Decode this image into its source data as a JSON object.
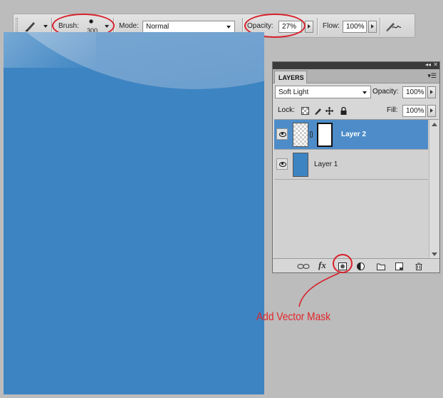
{
  "options_bar": {
    "brush_label": "Brush:",
    "brush_size": "300",
    "mode_label": "Mode:",
    "mode_value": "Normal",
    "opacity_label": "Opacity:",
    "opacity_value": "27%",
    "flow_label": "Flow:",
    "flow_value": "100%"
  },
  "layers_panel": {
    "tab_label": "LAYERS",
    "blend_mode": "Soft Light",
    "opacity_label": "Opacity:",
    "opacity_value": "100%",
    "lock_label": "Lock:",
    "fill_label": "Fill:",
    "fill_value": "100%",
    "layers": [
      {
        "name": "Layer 2",
        "selected": true
      },
      {
        "name": "Layer 1",
        "selected": false
      }
    ],
    "footer_fx": "fx"
  },
  "annotation": {
    "text": "Add Vector Mask",
    "color": "#e0262a"
  },
  "colors": {
    "canvas_blue": "#3d84c2",
    "selection_blue": "#4d8cc9",
    "annotation_red": "#d8202a"
  }
}
